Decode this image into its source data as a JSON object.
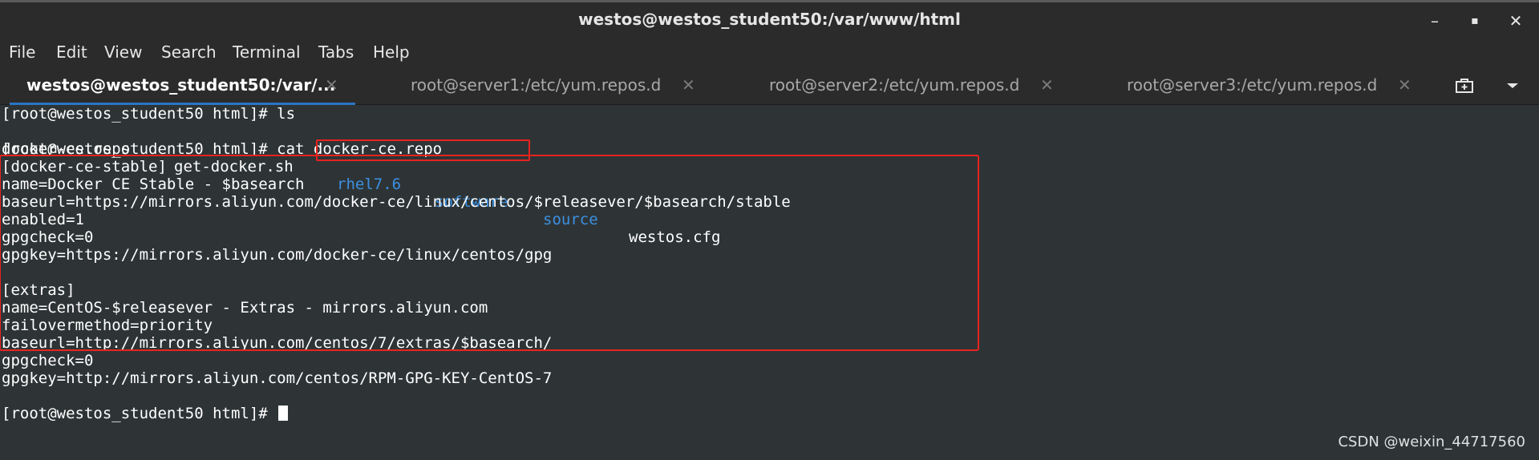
{
  "window": {
    "title": "westos@westos_student50:/var/www/html",
    "controls": {
      "minimize": "–",
      "maximize": "▪",
      "close": "✕"
    }
  },
  "menu": [
    "File",
    "Edit",
    "View",
    "Search",
    "Terminal",
    "Tabs",
    "Help"
  ],
  "tabs": [
    {
      "label": "westos@westos_student50:/var/...",
      "active": true
    },
    {
      "label": "root@server1:/etc/yum.repos.d",
      "active": false
    },
    {
      "label": "root@server2:/etc/yum.repos.d",
      "active": false
    },
    {
      "label": "root@server3:/etc/yum.repos.d",
      "active": false
    }
  ],
  "terminal": {
    "prompt": "[root@westos_student50 html]#",
    "cmd1": " ls",
    "ls_output": [
      {
        "name": "docker-ce.repo",
        "type": "file"
      },
      {
        "name": "get-docker.sh",
        "type": "file"
      },
      {
        "name": "rhel7.6",
        "type": "dir"
      },
      {
        "name": "software",
        "type": "dir"
      },
      {
        "name": "source",
        "type": "dir"
      },
      {
        "name": "westos.cfg",
        "type": "file"
      }
    ],
    "cmd2": " cat docker-ce.repo",
    "output": [
      "[docker-ce-stable]",
      "name=Docker CE Stable - $basearch",
      "baseurl=https://mirrors.aliyun.com/docker-ce/linux/centos/$releasever/$basearch/stable",
      "enabled=1",
      "gpgcheck=0",
      "gpgkey=https://mirrors.aliyun.com/docker-ce/linux/centos/gpg",
      "",
      "[extras]",
      "name=CentOS-$releasever - Extras - mirrors.aliyun.com",
      "failovermethod=priority",
      "baseurl=http://mirrors.aliyun.com/centos/7/extras/$basearch/",
      "gpgcheck=0",
      "gpgkey=http://mirrors.aliyun.com/centos/RPM-GPG-KEY-CentOS-7"
    ]
  },
  "watermark": "CSDN @weixin_44717560",
  "colors": {
    "highlight_border": "#e8231f",
    "directory": "#3c8fe0",
    "terminal_bg": "#2e3436",
    "active_tab_underline": "#2a76c6"
  }
}
